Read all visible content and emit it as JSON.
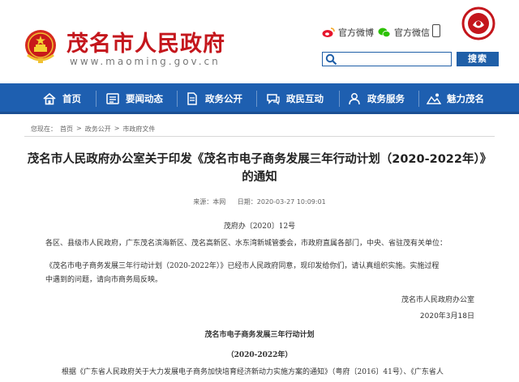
{
  "header": {
    "site_title": "茂名市人民政府",
    "site_url": "www.maoming.gov.cn",
    "weibo_label": "官方微博",
    "wechat_label": "官方微信",
    "search_placeholder": "",
    "search_button": "搜索"
  },
  "nav": {
    "items": [
      {
        "label": "首页",
        "icon": "home-icon"
      },
      {
        "label": "要闻动态",
        "icon": "news-icon"
      },
      {
        "label": "政务公开",
        "icon": "document-icon"
      },
      {
        "label": "政民互动",
        "icon": "chat-icon"
      },
      {
        "label": "政务服务",
        "icon": "service-icon"
      },
      {
        "label": "魅力茂名",
        "icon": "scenery-icon"
      }
    ]
  },
  "breadcrumb": {
    "prefix": "您现在：",
    "items": [
      "首页",
      "政务公开",
      "市政府文件"
    ]
  },
  "article": {
    "title_line1": "茂名市人民政府办公室关于印发《茂名市电子商务发展三年行动计划（2020-2022年）》",
    "title_line2": "的通知",
    "source_label": "来源：本网",
    "date_label": "日期：2020-03-27 10:09:01",
    "doc_number": "茂府办〔2020〕12号",
    "recipients": "各区、县级市人民政府，广东茂名滨海新区、茂名高新区、水东湾新城管委会，市政府直属各部门，中央、省驻茂有关单位：",
    "body1_line1": "《茂名市电子商务发展三年行动计划（2020-2022年）》已经市人民政府同意，现印发给你们，请认真组织实施。实施过程",
    "body1_line2": "中遇到的问题，请向市商务局反映。",
    "signer": "茂名市人民政府办公室",
    "sign_date": "2020年3月18日",
    "plan_title": "茂名市电子商务发展三年行动计划",
    "plan_subtitle": "（2020-2022年）",
    "body2_line1": "根据《广东省人民政府关于大力发展电子商务加快培育经济新动力实施方案的通知》（粤府〔2016〕41号）、《广东省人"
  },
  "colors": {
    "brand_red": "#c4161c",
    "nav_blue": "#1e5fb0",
    "search_blue": "#1f5fa8"
  }
}
